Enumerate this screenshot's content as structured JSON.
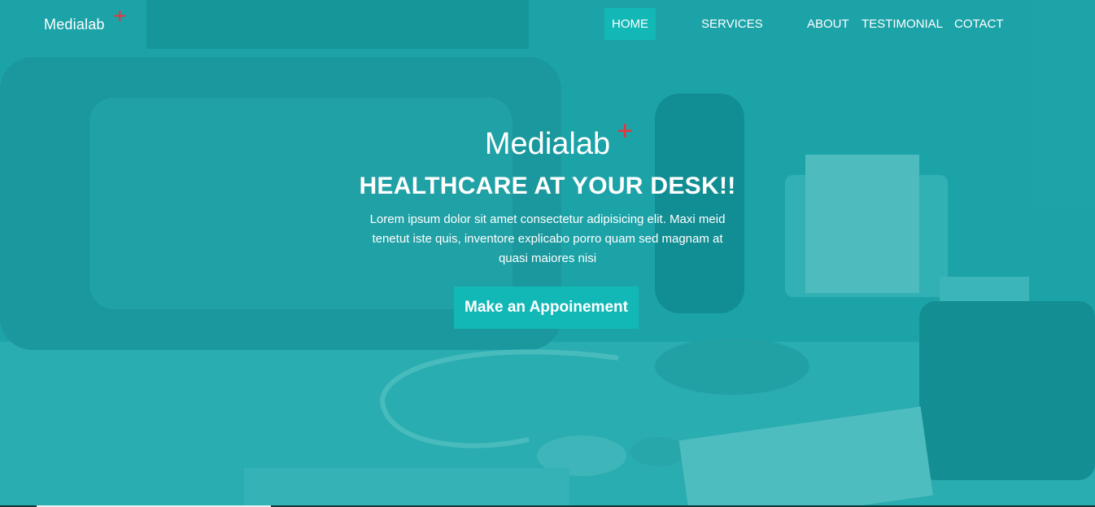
{
  "navbar": {
    "brand": "Medialab",
    "brand_mark": "+",
    "items": [
      {
        "label": "HOME",
        "active": true
      },
      {
        "label": "SERVICES",
        "active": false
      },
      {
        "label": "ABOUT",
        "active": false
      },
      {
        "label": "TESTIMONIAL",
        "active": false
      },
      {
        "label": "COTACT",
        "active": false
      }
    ]
  },
  "hero": {
    "brand": "Medialab",
    "brand_mark": "+",
    "headline": "HEALTHCARE AT YOUR DESK!!",
    "text": "Lorem ipsum dolor sit amet consectetur adipisicing elit. Maxi meid tenetut iste quis, inventore explicabo porro quam sed magnam at quasi maiores nisi",
    "cta_label": "Make an Appoinement"
  },
  "colors": {
    "accent": "#12b8b6",
    "overlay": "#1a9ea1",
    "plus": "#e8343b",
    "text": "#ffffff"
  }
}
